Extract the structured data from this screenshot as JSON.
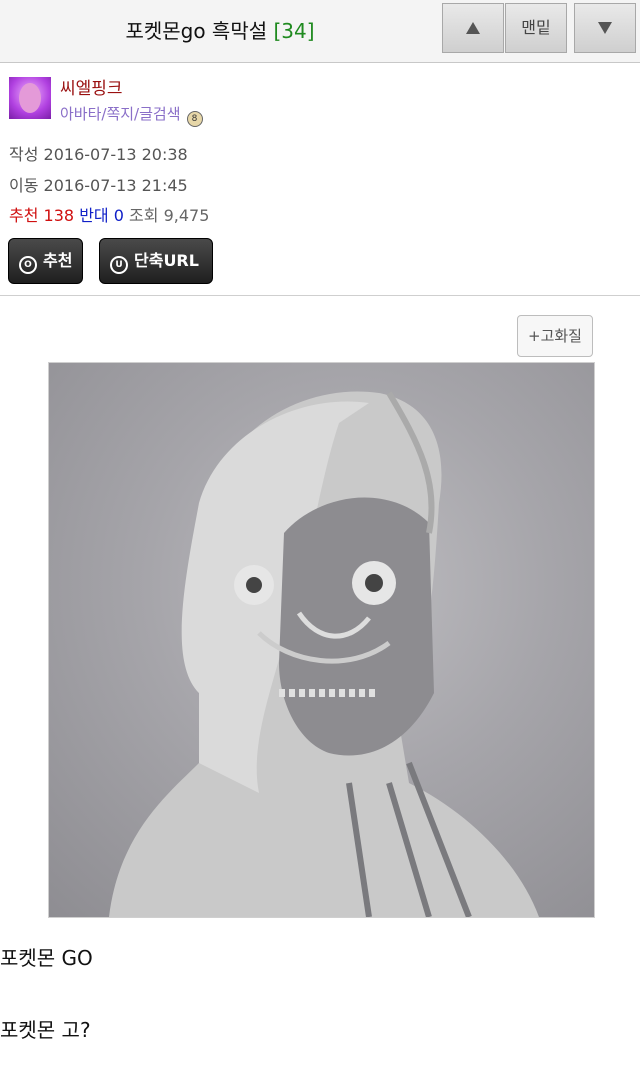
{
  "header": {
    "title": "포켓몬go 흑막설",
    "count": "[34]",
    "up_icon": "triangle-up-icon",
    "bottom_label": "맨밑",
    "down_icon": "triangle-down-icon"
  },
  "author": {
    "nickname": "씨엘핑크",
    "links": "아바타/쪽지/글검색",
    "badge_icon": "level-badge-icon"
  },
  "meta": {
    "written_label": "작성",
    "written_time": "2016-07-13 20:38",
    "moved_label": "이동",
    "moved_time": "2016-07-13 21:45",
    "recommend_label": "추천",
    "recommend_count": "138",
    "oppose_label": "반대",
    "oppose_count": "0",
    "views_label": "조회",
    "views_count": "9,475"
  },
  "actions": {
    "recommend_label": "추천",
    "recommend_icon_glyph": "O",
    "shorturl_label": "단축URL",
    "shorturl_icon_glyph": "U"
  },
  "image_tools": {
    "hq_label": "+고화질"
  },
  "body": {
    "line1": "포켓몬 GO",
    "line2": "포켓몬 고?"
  },
  "colors": {
    "count_green": "#1f8a1f",
    "nick_red": "#9a1010",
    "link_purple": "#8a6fc8",
    "recommend_red": "#d01010",
    "oppose_blue": "#1020c8"
  }
}
